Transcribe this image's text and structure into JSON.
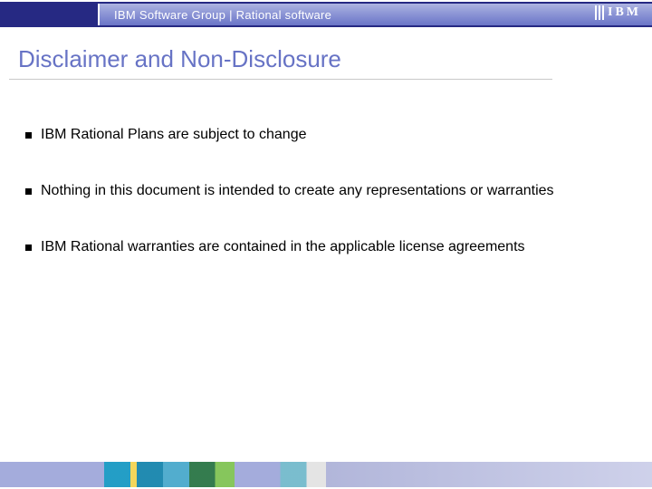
{
  "header": {
    "subtitle": "IBM Software Group | Rational software",
    "logo": "IBM"
  },
  "title": "Disclaimer and Non-Disclosure",
  "bullets": [
    "IBM Rational Plans are subject to change",
    "Nothing in this document is intended to create any representations or warranties",
    "IBM Rational warranties are contained in the applicable license agreements"
  ]
}
